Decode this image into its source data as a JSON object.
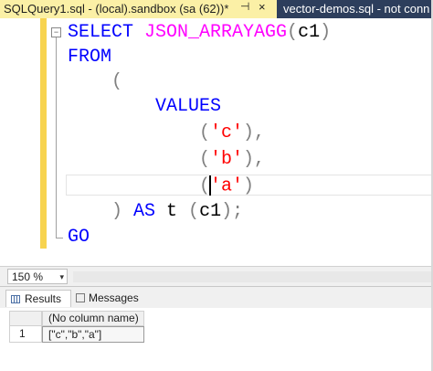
{
  "tabs": {
    "active": {
      "title": "SQLQuery1.sql - (local).sandbox (sa (62))*",
      "pin": "⊣",
      "close": "×"
    },
    "inactive": {
      "title": "vector-demos.sql - not conn"
    }
  },
  "code": {
    "lines": [
      {
        "tokens": [
          {
            "t": "SELECT ",
            "c": "kw"
          },
          {
            "t": "JSON_ARRAYAGG",
            "c": "fn"
          },
          {
            "t": "(",
            "c": "pun"
          },
          {
            "t": "c1",
            "c": "id"
          },
          {
            "t": ")",
            "c": "pun"
          }
        ]
      },
      {
        "tokens": [
          {
            "t": "FROM",
            "c": "kw"
          }
        ]
      },
      {
        "tokens": [
          {
            "t": "    (",
            "c": "pun"
          }
        ]
      },
      {
        "tokens": [
          {
            "t": "        VALUES",
            "c": "kw"
          }
        ]
      },
      {
        "tokens": [
          {
            "t": "            (",
            "c": "pun"
          },
          {
            "t": "'c'",
            "c": "str"
          },
          {
            "t": "),",
            "c": "pun"
          }
        ]
      },
      {
        "tokens": [
          {
            "t": "            (",
            "c": "pun"
          },
          {
            "t": "'b'",
            "c": "str"
          },
          {
            "t": "),",
            "c": "pun"
          }
        ]
      },
      {
        "tokens": [
          {
            "t": "            (",
            "c": "pun"
          },
          {
            "t": "CARET",
            "c": "caret"
          },
          {
            "t": "'a'",
            "c": "str"
          },
          {
            "t": ")",
            "c": "pun"
          }
        ]
      },
      {
        "tokens": [
          {
            "t": "    ) ",
            "c": "pun"
          },
          {
            "t": "AS ",
            "c": "kw"
          },
          {
            "t": "t ",
            "c": "id"
          },
          {
            "t": "(",
            "c": "pun"
          },
          {
            "t": "c1",
            "c": "id"
          },
          {
            "t": ");",
            "c": "pun"
          }
        ]
      },
      {
        "tokens": [
          {
            "t": "GO",
            "c": "kw"
          }
        ]
      }
    ]
  },
  "status": {
    "zoom": "150 %",
    "zoom_arrow": "▾"
  },
  "results": {
    "tab_results": "Results",
    "tab_messages": "Messages",
    "column_header": "(No column name)",
    "rows": [
      {
        "num": "1",
        "value": "[\"c\",\"b\",\"a\"]"
      }
    ]
  }
}
